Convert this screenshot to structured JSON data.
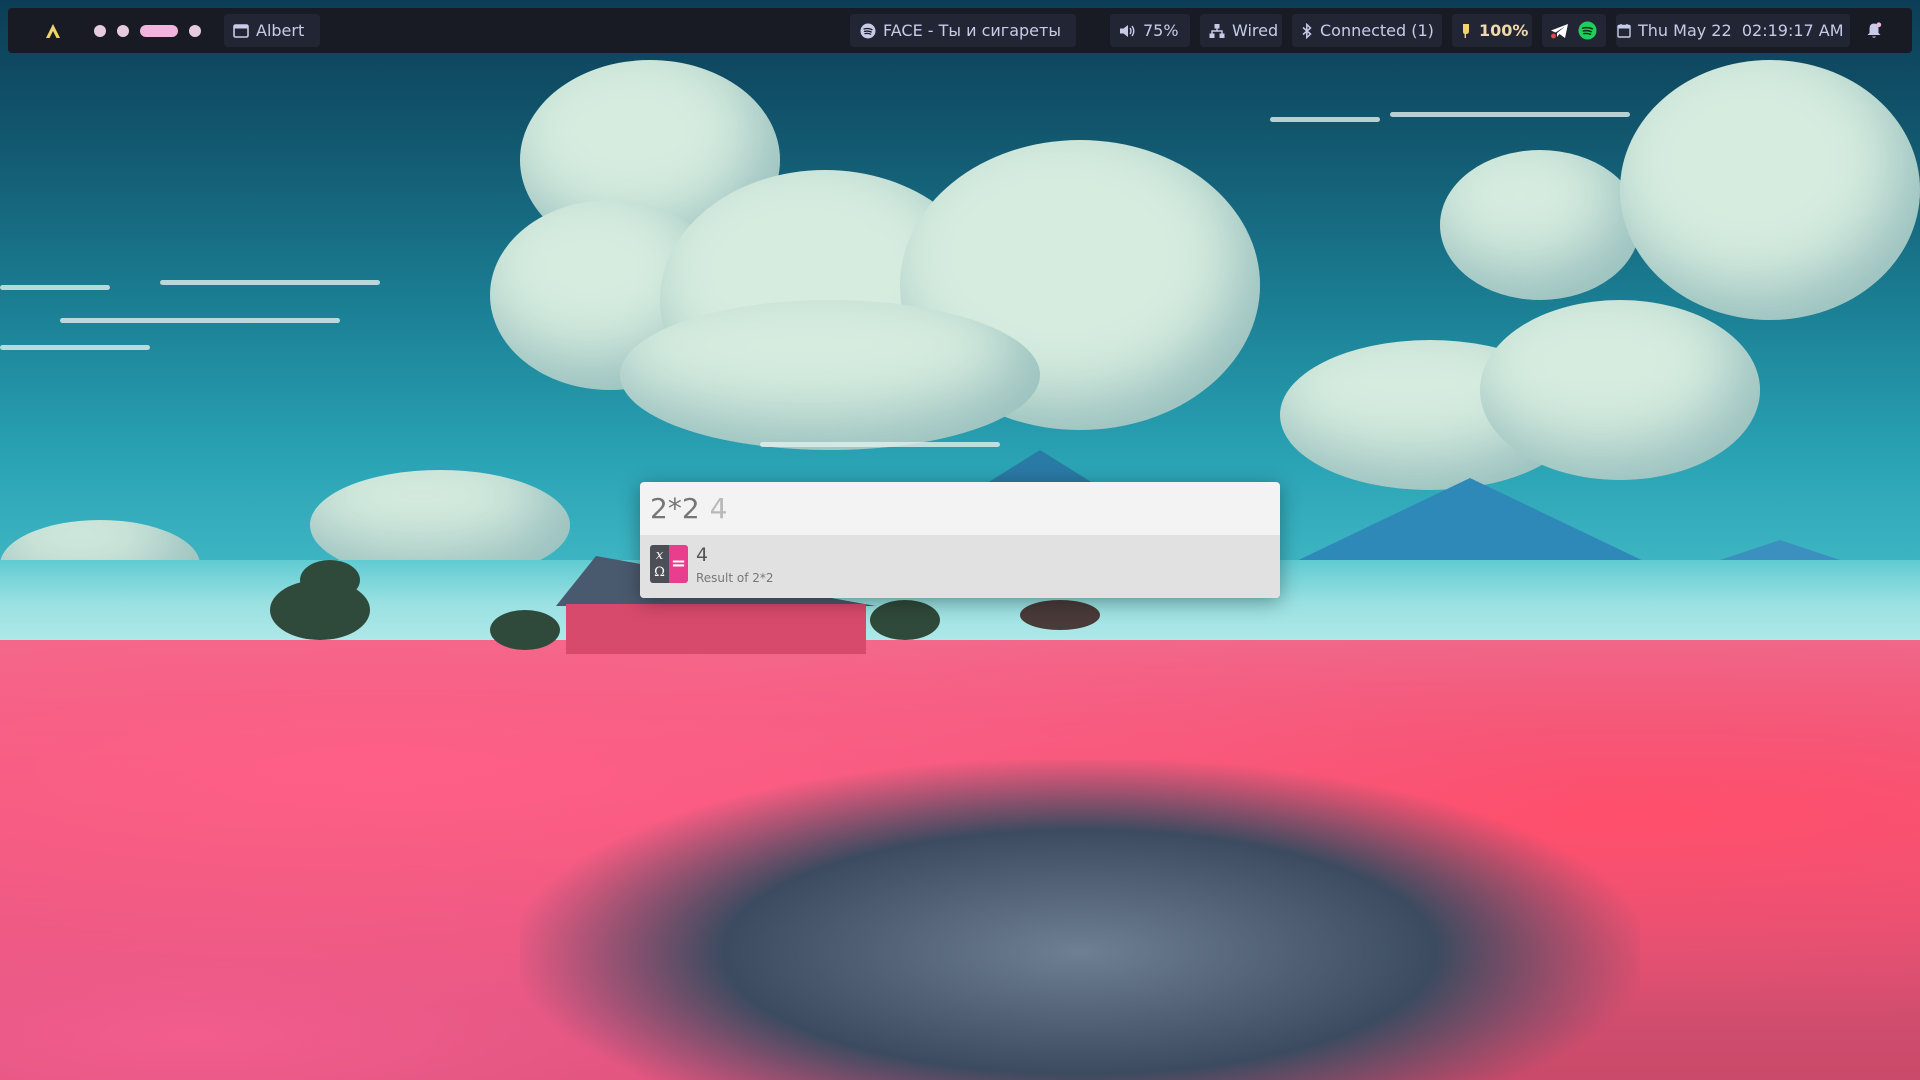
{
  "topbar": {
    "workspace_indicators": [
      "dot",
      "dot",
      "active-pill",
      "dot"
    ],
    "window_title": "Albert",
    "media": {
      "icon": "spotify-icon",
      "text": "FACE - Ты и сигареты"
    },
    "volume": "75%",
    "network": "Wired",
    "bluetooth": "Connected (1)",
    "battery": "100%",
    "tray": [
      "telegram-icon",
      "spotify-icon"
    ],
    "clock": "Thu May 22  02:19:17 AM",
    "notifications_icon": "bell-icon"
  },
  "launcher": {
    "query": "2*2",
    "completion": "4",
    "results": [
      {
        "icon": "calculator-icon",
        "title": "4",
        "subtitle": "Result of 2*2"
      }
    ]
  },
  "colors": {
    "bar_bg": "#181b24",
    "bar_fg": "#c7cbe8",
    "accent_pink": "#e93d8d",
    "launcher_bg": "#f3f3f3",
    "result_bg": "#e1e1e1"
  }
}
